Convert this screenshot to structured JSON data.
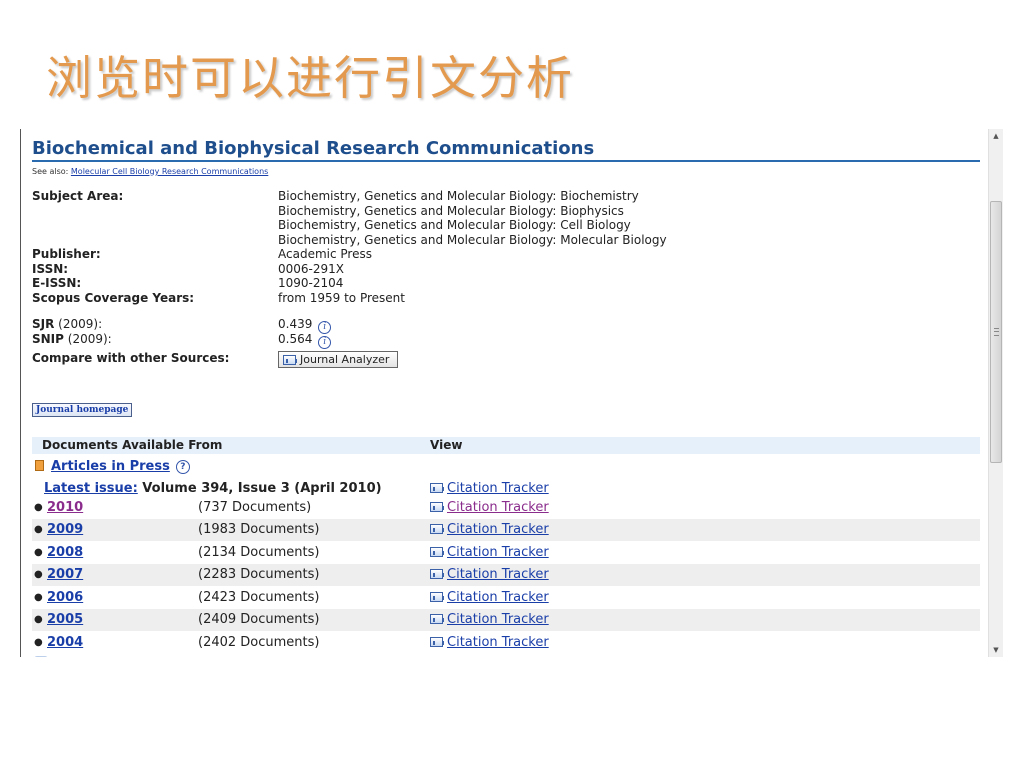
{
  "slide": {
    "title": "浏览时可以进行引文分析"
  },
  "journal": {
    "title": "Biochemical and Biophysical Research Communications",
    "see_also_label": "See also:",
    "see_also_link": "Molecular Cell Biology Research Communications"
  },
  "info": {
    "subject_label": "Subject Area:",
    "subjects": [
      "Biochemistry, Genetics and Molecular Biology: Biochemistry",
      "Biochemistry, Genetics and Molecular Biology: Biophysics",
      "Biochemistry, Genetics and Molecular Biology: Cell Biology",
      "Biochemistry, Genetics and Molecular Biology: Molecular Biology"
    ],
    "publisher_label": "Publisher:",
    "publisher": "Academic Press",
    "issn_label": "ISSN:",
    "issn": "0006-291X",
    "eissn_label": "E-ISSN:",
    "eissn": "1090-2104",
    "coverage_label": "Scopus Coverage Years:",
    "coverage": "from 1959 to Present",
    "sjr_label": "SJR",
    "sjr_year": " (2009):",
    "sjr": "0.439",
    "snip_label": "SNIP",
    "snip_year": " (2009):",
    "snip": "0.564",
    "compare_label": "Compare with other Sources:",
    "analyzer_button": "Journal Analyzer",
    "homepage_button": "Journal homepage"
  },
  "table": {
    "col_docs": "Documents Available From",
    "col_view": "View",
    "articles_in_press": "Articles in Press",
    "latest_label": "Latest issue:",
    "latest_text": " Volume 394, Issue 3 (April 2010)",
    "citation_tracker": "Citation Tracker",
    "rows": [
      {
        "year": "2010",
        "docs": "(737 Documents)",
        "link": "Citation Tracker"
      },
      {
        "year": "2009",
        "docs": "(1983 Documents)",
        "link": "Citation Tracker"
      },
      {
        "year": "2008",
        "docs": "(2134 Documents)",
        "link": "Citation Tracker"
      },
      {
        "year": "2007",
        "docs": "(2283 Documents)",
        "link": "Citation Tracker"
      },
      {
        "year": "2006",
        "docs": "(2423 Documents)",
        "link": "Citation Tracker"
      },
      {
        "year": "2005",
        "docs": "(2409 Documents)",
        "link": "Citation Tracker"
      },
      {
        "year": "2004",
        "docs": "(2402 Documents)",
        "link": "Citation Tracker"
      }
    ]
  },
  "colors": {
    "title_orange": "#e39a4e",
    "link_blue": "#1a3ea8",
    "visited_purple": "#8a2c8c",
    "journal_title_blue": "#1f4e8c"
  }
}
